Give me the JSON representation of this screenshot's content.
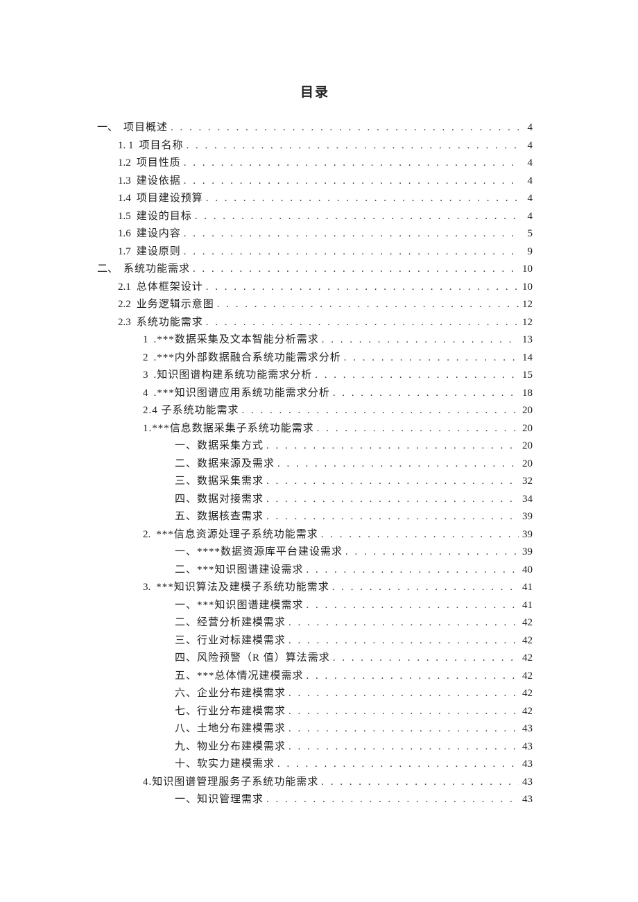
{
  "title": "目录",
  "toc": [
    {
      "level": 1,
      "num": "一、",
      "label": "项目概述",
      "page": "4"
    },
    {
      "level": 2,
      "num": "1. 1",
      "label": "项目名称",
      "page": "4"
    },
    {
      "level": 2,
      "num": "1.2",
      "label": "项目性质",
      "page": "4"
    },
    {
      "level": 2,
      "num": "1.3",
      "label": "建设依据",
      "page": "4"
    },
    {
      "level": 2,
      "num": "1.4",
      "label": "项目建设预算",
      "page": "4"
    },
    {
      "level": 2,
      "num": "1.5",
      "label": "建设的目标",
      "page": "4"
    },
    {
      "level": 2,
      "num": "1.6",
      "label": "建设内容",
      "page": "5"
    },
    {
      "level": 2,
      "num": "1.7",
      "label": "建设原则",
      "page": "9"
    },
    {
      "level": 1,
      "num": "二、",
      "label": "系统功能需求",
      "page": "10"
    },
    {
      "level": 2,
      "num": "2.1",
      "label": "总体框架设计",
      "page": "10"
    },
    {
      "level": 2,
      "num": "2.2",
      "label": "业务逻辑示意图",
      "page": "12"
    },
    {
      "level": 2,
      "num": "2.3",
      "label": "系统功能需求",
      "page": "12"
    },
    {
      "level": 3,
      "num": "1",
      "label": ".***数据采集及文本智能分析需求",
      "page": "13"
    },
    {
      "level": 3,
      "num": "2",
      "label": ".***内外部数据融合系统功能需求分析",
      "page": "14"
    },
    {
      "level": 3,
      "num": "3",
      "label": ".知识图谱构建系统功能需求分析",
      "page": "15"
    },
    {
      "level": 3,
      "num": "4",
      "label": ".***知识图谱应用系统功能需求分析",
      "page": "18"
    },
    {
      "level": 3,
      "num": "",
      "label": "2.4 子系统功能需求",
      "page": "20"
    },
    {
      "level": 3,
      "num": "",
      "label": "1.***信息数据采集子系统功能需求",
      "page": "20"
    },
    {
      "level": 4,
      "num": "",
      "label": "一、数据采集方式",
      "page": "20"
    },
    {
      "level": 4,
      "num": "",
      "label": "二、数据来源及需求",
      "page": "20"
    },
    {
      "level": 4,
      "num": "",
      "label": "三、数据采集需求",
      "page": "32"
    },
    {
      "level": 4,
      "num": "",
      "label": "四、数据对接需求",
      "page": "34"
    },
    {
      "level": 4,
      "num": "",
      "label": "五、数据核查需求",
      "page": "39"
    },
    {
      "level": 3,
      "num": "2.",
      "label": "***信息资源处理子系统功能需求",
      "page": "39"
    },
    {
      "level": 4,
      "num": "",
      "label": "一、****数据资源库平台建设需求",
      "page": "39"
    },
    {
      "level": 4,
      "num": "",
      "label": "二、***知识图谱建设需求",
      "page": "40"
    },
    {
      "level": 3,
      "num": "3.",
      "label": "***知识算法及建模子系统功能需求",
      "page": "41"
    },
    {
      "level": 4,
      "num": "",
      "label": "一、***知识图谱建模需求",
      "page": "41"
    },
    {
      "level": 4,
      "num": "",
      "label": "二、经营分析建模需求",
      "page": "42"
    },
    {
      "level": 4,
      "num": "",
      "label": "三、行业对标建模需求",
      "page": "42"
    },
    {
      "level": 4,
      "num": "",
      "label": "四、风险预警（R 值）算法需求",
      "page": "42"
    },
    {
      "level": 4,
      "num": "",
      "label": "五、***总体情况建模需求",
      "page": "42"
    },
    {
      "level": 4,
      "num": "",
      "label": "六、企业分布建模需求",
      "page": "42"
    },
    {
      "level": 4,
      "num": "",
      "label": "七、行业分布建模需求",
      "page": "42"
    },
    {
      "level": 4,
      "num": "",
      "label": "八、土地分布建模需求",
      "page": "43"
    },
    {
      "level": 4,
      "num": "",
      "label": "九、物业分布建模需求",
      "page": "43"
    },
    {
      "level": 4,
      "num": "",
      "label": "十、软实力建模需求",
      "page": "43"
    },
    {
      "level": 3,
      "num": "",
      "label": "4.知识图谱管理服务子系统功能需求",
      "page": "43"
    },
    {
      "level": 4,
      "num": "",
      "label": "一、知识管理需求",
      "page": "43"
    }
  ]
}
